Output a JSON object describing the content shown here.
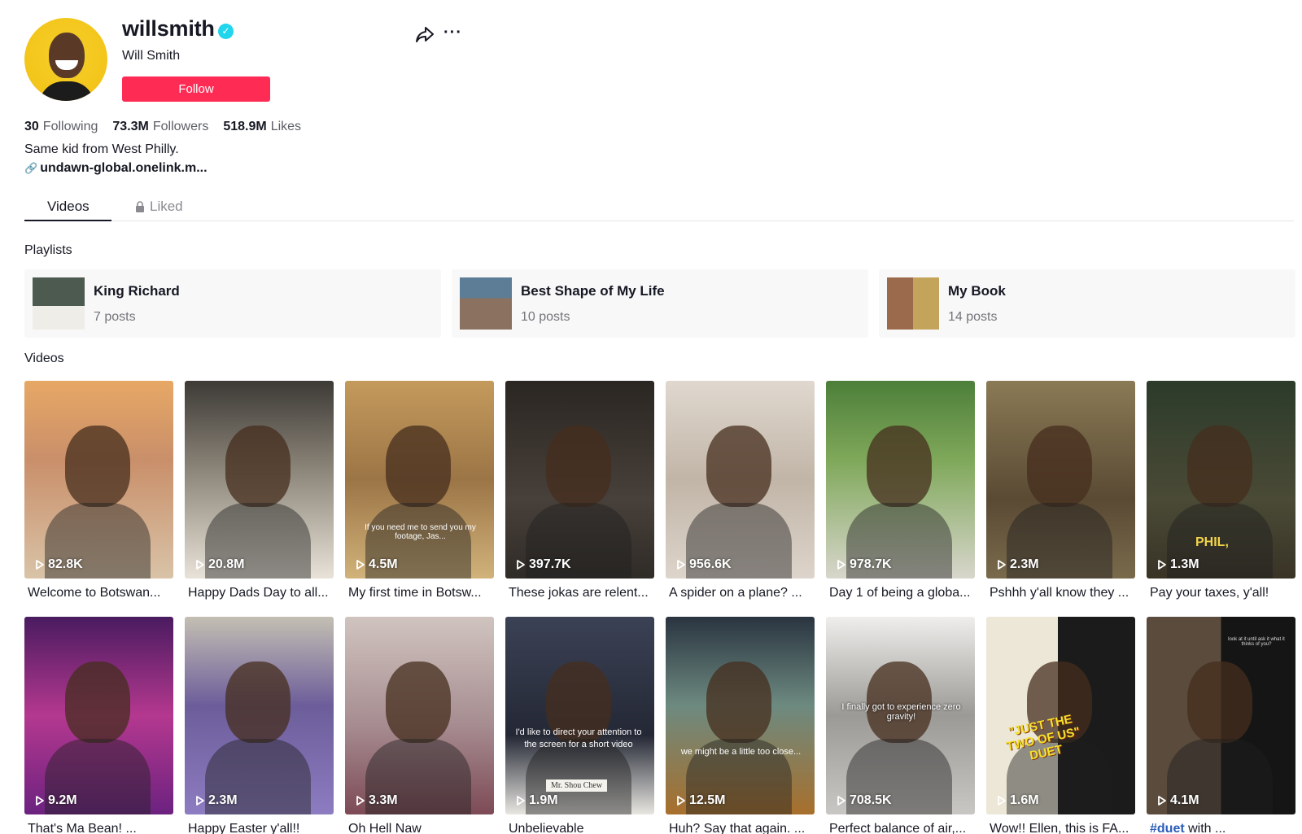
{
  "profile": {
    "username": "willsmith",
    "nickname": "Will Smith",
    "follow_label": "Follow",
    "bio": "Same kid from West Philly.",
    "link": "undawn-global.onelink.m...",
    "stats": {
      "following_count": "30",
      "following_label": "Following",
      "followers_count": "73.3M",
      "followers_label": "Followers",
      "likes_count": "518.9M",
      "likes_label": "Likes"
    }
  },
  "tabs": {
    "videos": "Videos",
    "liked": "Liked"
  },
  "sections": {
    "playlists": "Playlists",
    "videos": "Videos"
  },
  "playlists": [
    {
      "title": "King Richard",
      "count": "7 posts"
    },
    {
      "title": "Best Shape of My Life",
      "count": "10 posts"
    },
    {
      "title": "My Book",
      "count": "14 posts"
    }
  ],
  "videos": [
    {
      "views": "82.8K",
      "caption": "Welcome to Botswan...",
      "bg": "#c9916a"
    },
    {
      "views": "20.8M",
      "caption": "Happy Dads Day to all...",
      "bg": "#8a8377"
    },
    {
      "views": "4.5M",
      "caption": "My first time in Botsw...",
      "bg": "#b98a55"
    },
    {
      "views": "397.7K",
      "caption": "These jokas are relent...",
      "bg": "#3a352f"
    },
    {
      "views": "956.6K",
      "caption": "A spider on a plane? ...",
      "bg": "#c4b9ad"
    },
    {
      "views": "978.7K",
      "caption": "Day 1 of being a globa...",
      "bg": "#6b8f4a"
    },
    {
      "views": "2.3M",
      "caption": "Pshhh y'all know they ...",
      "bg": "#6d5f43"
    },
    {
      "views": "1.3M",
      "caption": "Pay your taxes, y'all!",
      "bg": "#3c3a2c"
    },
    {
      "views": "9.2M",
      "caption": "That's Ma Bean! ...",
      "bg": "#8e2a86"
    },
    {
      "views": "2.3M",
      "caption": "Happy Easter y'all!!",
      "bg": "#9d9a93"
    },
    {
      "views": "3.3M",
      "caption": "Oh Hell Naw",
      "bg": "#b59ea0"
    },
    {
      "views": "1.9M",
      "caption": "Unbelievable",
      "bg": "#2e3340"
    },
    {
      "views": "12.5M",
      "caption": "Huh? Say that again. ...",
      "bg": "#3c4a50"
    },
    {
      "views": "708.5K",
      "caption": "Perfect balance of air,...",
      "bg": "#9a9a98"
    },
    {
      "views": "1.6M",
      "caption": "Wow!! Ellen, this is FA...",
      "bg": "#1a1a1a"
    },
    {
      "views": "4.1M",
      "caption_tag": "#duet",
      "caption_rest": " with ...",
      "bg": "#4a4036"
    }
  ],
  "overlay_texts": {
    "v3": "If you need me to send you my footage, Jas...",
    "v8": "PHIL,",
    "v12": "I'd like to direct your attention to the screen for a short video",
    "v12_plate": "Mr. Shou Chew",
    "v13": "we might be a little too close...",
    "v14": "I finally got to experience zero gravity!",
    "v15": "\"JUST THE TWO OF US\" DUET",
    "v16": "look at it until ask it what it thinks of you?"
  },
  "colors": {
    "accent": "#fe2c55",
    "verified": "#20d5ec",
    "hashtag": "#2b5db9"
  },
  "icons": [
    "verified-badge-icon",
    "share-icon",
    "more-icon",
    "link-icon",
    "lock-icon",
    "play-icon"
  ]
}
